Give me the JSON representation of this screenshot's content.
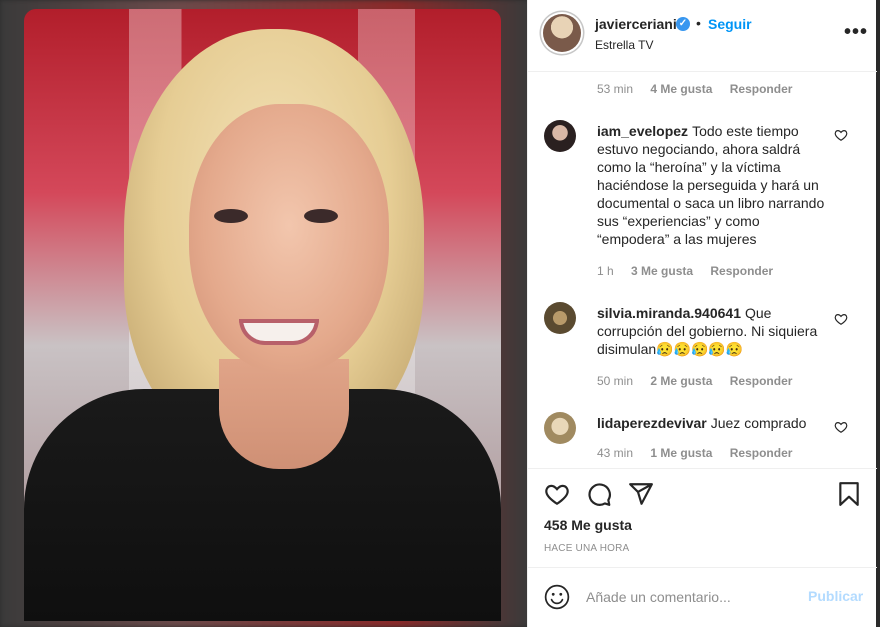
{
  "header": {
    "username": "javierceriani",
    "separator": "•",
    "follow_label": "Seguir",
    "location": "Estrella TV",
    "more_label": "•••"
  },
  "comments": [
    {
      "user": "",
      "text": "",
      "time": "53 min",
      "likes": "4 Me gusta",
      "reply": "Responder"
    },
    {
      "user": "iam_evelopez",
      "text": "Todo este tiempo estuvo negociando, ahora saldrá como la “heroína” y la víctima haciéndose la perseguida y hará un documental o saca un libro narrando sus “experiencias” y como “empodera” a las mujeres",
      "time": "1 h",
      "likes": "3 Me gusta",
      "reply": "Responder"
    },
    {
      "user": "silvia.miranda.940641",
      "text": "Que corrupción del gobierno. Ni siquiera disimulan😥😥😥😥😥",
      "time": "50 min",
      "likes": "2 Me gusta",
      "reply": "Responder"
    },
    {
      "user": "lidaperezdevivar",
      "text": "Juez comprado",
      "time": "43 min",
      "likes": "1 Me gusta",
      "reply": "Responder"
    }
  ],
  "actions": {
    "likes_total": "458 Me gusta",
    "posted_ago": "HACE UNA HORA"
  },
  "add_comment": {
    "placeholder": "Añade un comentario...",
    "publish_label": "Publicar"
  },
  "colors": {
    "link_blue": "#0095f6",
    "publish_disabled": "#b3dbff",
    "muted": "#8e8e8e",
    "verified": "#3897f0"
  },
  "icons": [
    "verified-badge-icon",
    "more-options-icon",
    "heart-icon",
    "comment-icon",
    "share-icon",
    "bookmark-icon",
    "emoji-icon"
  ]
}
